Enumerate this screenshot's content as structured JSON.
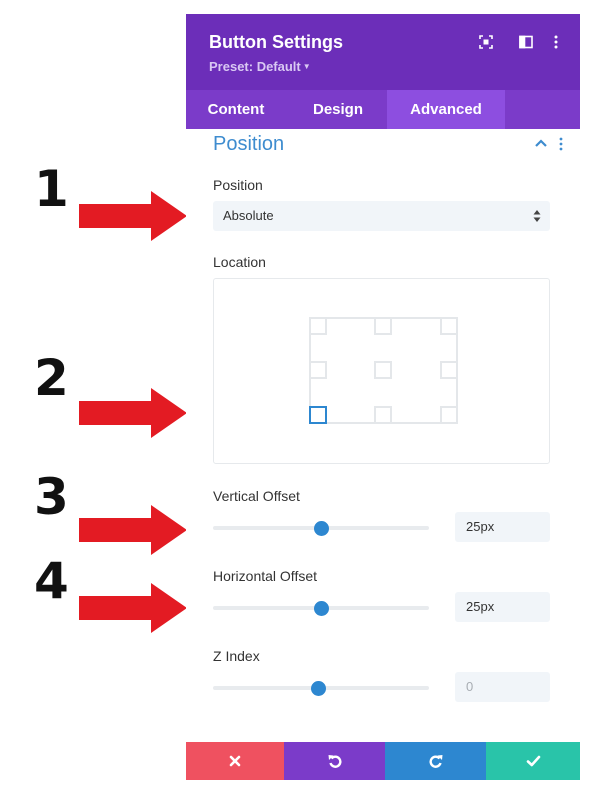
{
  "annotations": [
    {
      "number": "1"
    },
    {
      "number": "2"
    },
    {
      "number": "3"
    },
    {
      "number": "4"
    }
  ],
  "colors": {
    "header": "#6c2eb9",
    "tabs": "#7b3bc9",
    "tab_active": "#8d4ee0",
    "accent_blue": "#2d87d0",
    "arrow_red": "#e31b23",
    "cancel": "#ef5160",
    "undo": "#7b3bc9",
    "redo": "#2d87d0",
    "save": "#29c4a9"
  },
  "header": {
    "title": "Button Settings",
    "preset": "Preset: Default",
    "icons": [
      "focus-icon",
      "sidebar-layout-icon",
      "more-vertical-icon"
    ]
  },
  "tabs": [
    {
      "label": "Content",
      "active": false
    },
    {
      "label": "Design",
      "active": false
    },
    {
      "label": "Advanced",
      "active": true
    }
  ],
  "section": {
    "title": "Position",
    "expanded": true
  },
  "fields": {
    "position": {
      "label": "Position",
      "value": "Absolute"
    },
    "location": {
      "label": "Location",
      "selected": "bottom-left"
    },
    "vertical_offset": {
      "label": "Vertical Offset",
      "value": "25px",
      "slider_fraction": 0.5
    },
    "horizontal_offset": {
      "label": "Horizontal Offset",
      "value": "25px",
      "slider_fraction": 0.5
    },
    "z_index": {
      "label": "Z Index",
      "placeholder": "0",
      "slider_fraction": 0.49
    }
  },
  "footer": {
    "buttons": [
      "cancel-icon",
      "undo-icon",
      "redo-icon",
      "save-check-icon"
    ]
  }
}
